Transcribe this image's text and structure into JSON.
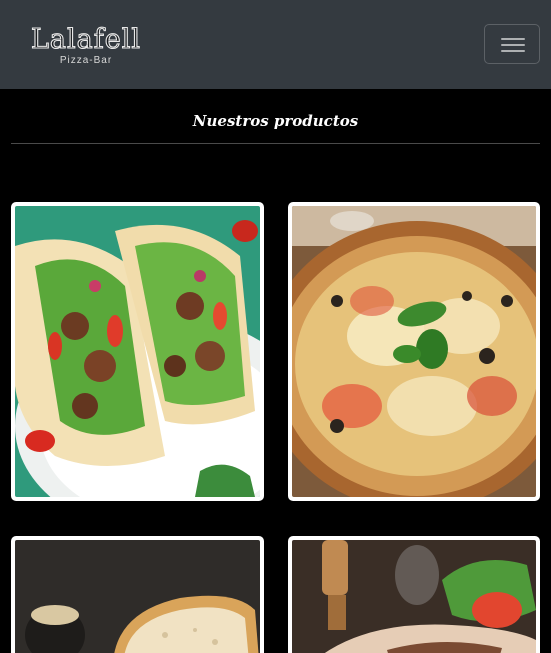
{
  "brand": {
    "name": "Lalafell",
    "tagline": "Pizza-Bar"
  },
  "nav": {
    "toggle_icon": "hamburger-icon"
  },
  "section": {
    "title": "Nuestros productos"
  },
  "products": [
    {
      "image": "tacos-photo"
    },
    {
      "image": "pizza-margherita-photo"
    },
    {
      "image": "bread-photo"
    },
    {
      "image": "grilled-meat-salad-photo"
    }
  ],
  "colors": {
    "navbar": "#343a40",
    "page": "#000000",
    "card": "#ffffff"
  }
}
